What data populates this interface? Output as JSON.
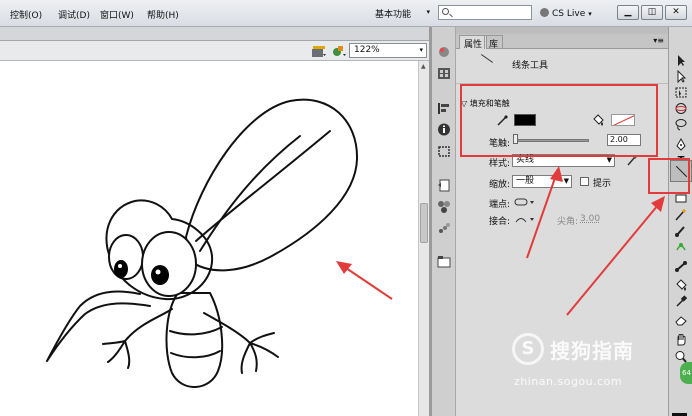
{
  "menu": {
    "items": [
      "控制(O)",
      "调试(D)",
      "窗口(W)",
      "帮助(H)"
    ],
    "workspace": "基本功能",
    "search_placeholder": "",
    "cs_live": "CS Live",
    "window_buttons": [
      "▁",
      "◫",
      "✕"
    ]
  },
  "document": {
    "zoom": "122%"
  },
  "panel": {
    "tabs": [
      "属性",
      "库"
    ],
    "menu_glyph": "▾≡",
    "tool_name": "线条工具",
    "section_fill_stroke": "▽ 填充和笔触",
    "stroke_label": "笔触:",
    "stroke_value": "2.00",
    "style_label": "样式:",
    "style_value": "实线",
    "scale_label": "缩放:",
    "scale_value": "一般",
    "hint_label": "提示",
    "cap_label": "端点:",
    "join_label": "接合:",
    "miter_label": "尖角:",
    "miter_value": "3.00"
  },
  "toolbox": {
    "text_tool_glyph": "T",
    "badge": "64"
  },
  "colors": {
    "annotation_red": "#e23b3b",
    "stroke_color": "#000000"
  },
  "watermark": {
    "logo": "S",
    "brand": "搜狗指南",
    "url": "zhinan.sogou.com"
  }
}
